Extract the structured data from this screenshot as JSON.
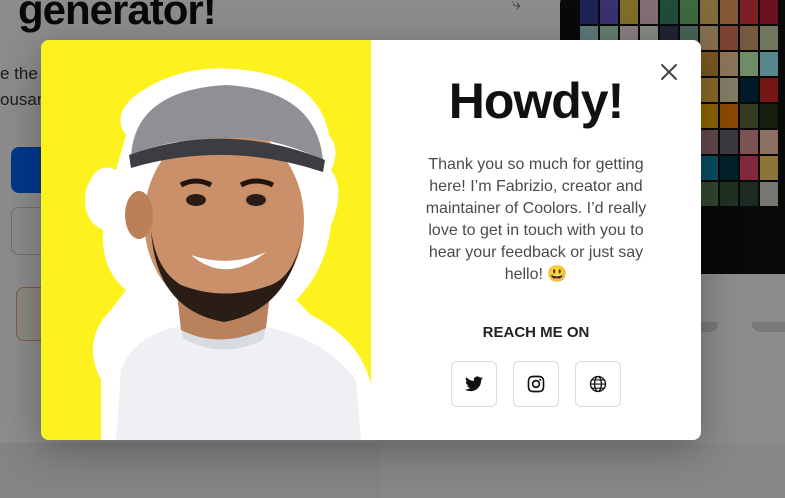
{
  "background": {
    "heading": "generator!",
    "line1": "e the",
    "line2": "ousan",
    "palette": [
      "#3b3f9e",
      "#6a5acd",
      "#e7c84a",
      "#f2c6d6",
      "#3b8d6a",
      "#6fbf73",
      "#e9c46a",
      "#f4a261",
      "#e63946",
      "#c41e3a",
      "#a8dadc",
      "#b7e4c7",
      "#ffe5ec",
      "#f1faee",
      "#3d405b",
      "#81b29a",
      "#f2cc8f",
      "#e07a5f",
      "#d4a373",
      "#ccd5ae",
      "#e9edc9",
      "#fefae0",
      "#faedcd",
      "#d4a5a5",
      "#9e2a2b",
      "#540b0e",
      "#e09f3e",
      "#ffd6a5",
      "#caffbf",
      "#9bf6ff",
      "#a0c4ff",
      "#bdb2ff",
      "#ffc6ff",
      "#fdffb6",
      "#ffadad",
      "#f77f00",
      "#fcbf49",
      "#eae2b7",
      "#003049",
      "#d62828",
      "#2a9d8f",
      "#264653",
      "#e76f51",
      "#8ecae6",
      "#219ebc",
      "#023047",
      "#ffb703",
      "#fb8500",
      "#606c38",
      "#283618",
      "#7f5539",
      "#b08968",
      "#ddb892",
      "#e6ccb2",
      "#ede0d4",
      "#9c6644",
      "#b5838d",
      "#6d6875",
      "#e5989b",
      "#ffcdb2",
      "#3a86ff",
      "#8338ec",
      "#ff006e",
      "#fb5607",
      "#ffbe0b",
      "#06d6a0",
      "#118ab2",
      "#073b4c",
      "#ef476f",
      "#ffd166",
      "#8d99ae",
      "#2b2d42",
      "#edf2f4",
      "#ef233c",
      "#d90429",
      "#a3b18a",
      "#588157",
      "#3a5a40",
      "#344e41",
      "#dad7cd"
    ]
  },
  "modal": {
    "title": "Howdy!",
    "message": "Thank you so much for getting here! I’m Fabrizio, creator and maintainer of Coolors. I’d really love to get in touch with you to hear your feedback or just say hello! 😃",
    "reach_label": "REACH ME ON",
    "photo_bg": "#fdf21d",
    "social": [
      {
        "name": "twitter",
        "icon": "twitter-icon"
      },
      {
        "name": "instagram",
        "icon": "instagram-icon"
      },
      {
        "name": "website",
        "icon": "globe-icon"
      }
    ]
  }
}
